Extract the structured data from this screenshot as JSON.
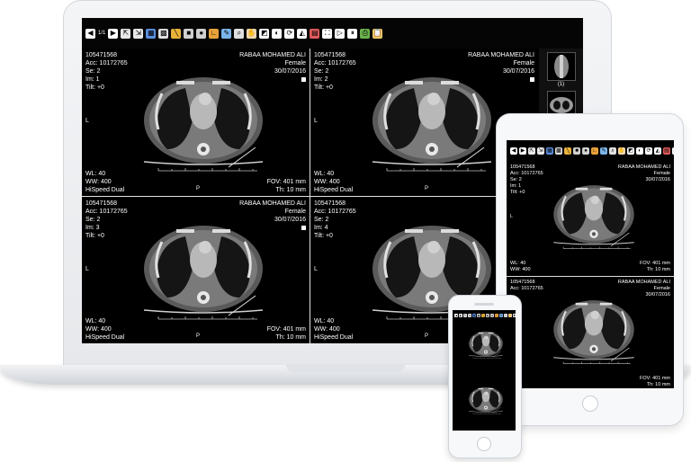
{
  "toolbar": {
    "image_counter": "1/1",
    "icons": [
      {
        "name": "prev-image-icon",
        "glyph": "◀",
        "color": "#ffffff"
      },
      {
        "name": "next-image-icon",
        "glyph": "▶",
        "color": "#ffffff"
      },
      {
        "name": "export-icon",
        "glyph": "⇱",
        "color": "#e8e8e8"
      },
      {
        "name": "save-icon",
        "glyph": "⇲",
        "color": "#e8e8e8"
      },
      {
        "name": "layout-grid-icon",
        "glyph": "▦",
        "color": "#5b8fe0"
      },
      {
        "name": "series-layout-icon",
        "glyph": "▩",
        "color": "#e0e0e0"
      },
      {
        "name": "measure-line-icon",
        "glyph": "╲",
        "color": "#e8b23a"
      },
      {
        "name": "rectangle-roi-icon",
        "glyph": "■",
        "color": "#d0d0d0"
      },
      {
        "name": "ellipse-roi-icon",
        "glyph": "●",
        "color": "#d0d0d0"
      },
      {
        "name": "angle-tool-icon",
        "glyph": "∟",
        "color": "#e8a23a"
      },
      {
        "name": "annotate-pen-icon",
        "glyph": "✎",
        "color": "#7ab4e8"
      },
      {
        "name": "magnifier-icon",
        "glyph": "⌕",
        "color": "#e0e0e0"
      },
      {
        "name": "pan-hand-icon",
        "glyph": "✋",
        "color": "#f0d7b0"
      },
      {
        "name": "window-level-icon",
        "glyph": "◩",
        "color": "#ffffff"
      },
      {
        "name": "invert-icon",
        "glyph": "◐",
        "color": "#ffffff"
      },
      {
        "name": "rotate-icon",
        "glyph": "⟳",
        "color": "#ffffff"
      },
      {
        "name": "flip-icon",
        "glyph": "◭",
        "color": "#ffffff"
      },
      {
        "name": "cine-grid-icon",
        "glyph": "▤",
        "color": "#e05b5b"
      },
      {
        "name": "fullscreen-icon",
        "glyph": "⛶",
        "color": "#ffffff"
      },
      {
        "name": "play-icon",
        "glyph": "▷",
        "color": "#ffffff"
      },
      {
        "name": "pause-icon",
        "glyph": "⏸",
        "color": "#ffffff"
      },
      {
        "name": "print-icon",
        "glyph": "⎙",
        "color": "#6ab04c"
      },
      {
        "name": "clipboard-icon",
        "glyph": "📋",
        "color": "#e8c86a"
      }
    ]
  },
  "viewports": [
    {
      "id": "105471568",
      "acc": "Acc: 10172765",
      "se": "Se: 2",
      "im": "Im: 1",
      "tilt": "Tilt: +0",
      "patient": "RABAA MOHAMED ALI",
      "sex": "Female",
      "date": "30/07/2016",
      "orientation": "L",
      "wl": "WL: 40",
      "ww": "WW: 400",
      "scanner": "HiSpeed Dual",
      "fov": "FOV: 401 mm",
      "th": "Th: 10 mm",
      "marker": "P"
    },
    {
      "id": "105471568",
      "acc": "Acc: 10172765",
      "se": "Se: 2",
      "im": "Im: 2",
      "tilt": "Tilt: +0",
      "patient": "RABAA MOHAMED ALI",
      "sex": "Female",
      "date": "30/07/2016",
      "orientation": "L",
      "wl": "WL: 40",
      "ww": "WW: 400",
      "scanner": "HiSpeed Dual",
      "fov": "",
      "th": "",
      "marker": "P"
    },
    {
      "id": "105471568",
      "acc": "Acc: 10172765",
      "se": "Se: 2",
      "im": "Im: 3",
      "tilt": "Tilt: +0",
      "patient": "RABAA MOHAMED ALI",
      "sex": "Female",
      "date": "30/07/2016",
      "orientation": "L",
      "wl": "WL: 40",
      "ww": "WW: 400",
      "scanner": "HiSpeed Dual",
      "fov": "FOV: 401 mm",
      "th": "Th: 10 mm",
      "marker": "P"
    },
    {
      "id": "105471568",
      "acc": "Acc: 10172765",
      "se": "Se: 2",
      "im": "Im: 4",
      "tilt": "Tilt: +0",
      "patient": "RABAA",
      "sex": "",
      "date": "",
      "orientation": "L",
      "wl": "WL: 40",
      "ww": "WW: 400",
      "scanner": "HiSpeed Dual",
      "fov": "",
      "th": "",
      "marker": "P"
    }
  ],
  "series_strip": {
    "thumb_label": "(1)"
  },
  "tablet": {
    "viewports": [
      {
        "id": "105471568",
        "acc": "Acc: 10172765",
        "se": "Se: 2",
        "im": "Im: 1",
        "tilt": "Tilt: +0",
        "patient": "RABAA MOHAMED ALI",
        "sex": "Female",
        "date": "30/07/2016",
        "orientation": "L",
        "wl": "WL: 40",
        "ww": "WW: 400",
        "fov": "FOV: 401 mm",
        "th": "Th: 10 mm"
      },
      {
        "id": "105471568",
        "acc": "Acc: 10172765",
        "se": "",
        "im": "",
        "tilt": "",
        "patient": "RABAA MOHAMED ALI",
        "sex": "Female",
        "date": "30/07/2016",
        "orientation": "",
        "wl": "",
        "ww": "",
        "fov": "FOV: 401 mm",
        "th": "Th: 10 mm"
      }
    ]
  },
  "colors": {
    "viewer_bg": "#000000",
    "overlay_text": "#ffffff",
    "device_frame": "#f4f5f7"
  }
}
